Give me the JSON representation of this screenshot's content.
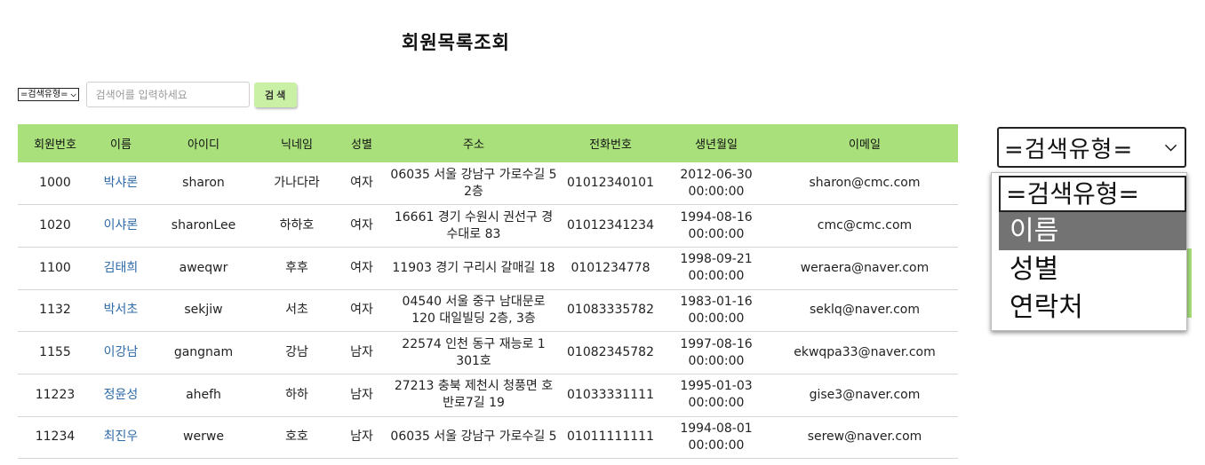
{
  "page": {
    "title": "회원목록조회"
  },
  "search": {
    "type_select": "=검색유형=",
    "placeholder": "검색어를 입력하세요",
    "button_label": "검 색"
  },
  "table": {
    "headers": [
      "회원번호",
      "이름",
      "아이디",
      "닉네임",
      "성별",
      "주소",
      "전화번호",
      "생년월일",
      "이메일"
    ],
    "rows": [
      [
        "1000",
        "박샤론",
        "sharon",
        "가나다라",
        "여자",
        "06035 서울 강남구 가로수길 5 2층",
        "01012340101",
        "2012-06-30 00:00:00",
        "sharon@cmc.com"
      ],
      [
        "1020",
        "이샤론",
        "sharonLee",
        "하하호",
        "여자",
        "16661 경기 수원시 권선구 경수대로 83",
        "01012341234",
        "1994-08-16 00:00:00",
        "cmc@cmc.com"
      ],
      [
        "1100",
        "김태희",
        "aweqwr",
        "후후",
        "여자",
        "11903 경기 구리시 갈매길 18",
        "0101234778",
        "1998-09-21 00:00:00",
        "weraera@naver.com"
      ],
      [
        "1132",
        "박서초",
        "sekjiw",
        "서초",
        "여자",
        "04540 서울 중구 남대문로 120 대일빌딩 2층, 3층",
        "01083335782",
        "1983-01-16 00:00:00",
        "seklq@naver.com"
      ],
      [
        "1155",
        "이강남",
        "gangnam",
        "강남",
        "남자",
        "22574 인천 동구 재능로 1 301호",
        "01082345782",
        "1997-08-16 00:00:00",
        "ekwqpa33@naver.com"
      ],
      [
        "11223",
        "정윤성",
        "ahefh",
        "하하",
        "남자",
        "27213 충북 제천시 청풍면 호반로7길 19",
        "01033331111",
        "1995-01-03 00:00:00",
        "gise3@naver.com"
      ],
      [
        "11234",
        "최진우",
        "werwe",
        "호호",
        "남자",
        "06035 서울 강남구 가로수길 5",
        "01011111111",
        "1994-08-01 00:00:00",
        "serew@naver.com"
      ]
    ]
  },
  "dropdown_preview": {
    "selected": "=검색유형=",
    "options": [
      "=검색유형=",
      "이름",
      "성별",
      "연락처"
    ],
    "highlighted_option": "이름"
  },
  "colors": {
    "header_bg": "#a9e07c",
    "button_bg": "#c9f0a5",
    "name_link": "#2f6ba8",
    "highlight": "#737373"
  }
}
